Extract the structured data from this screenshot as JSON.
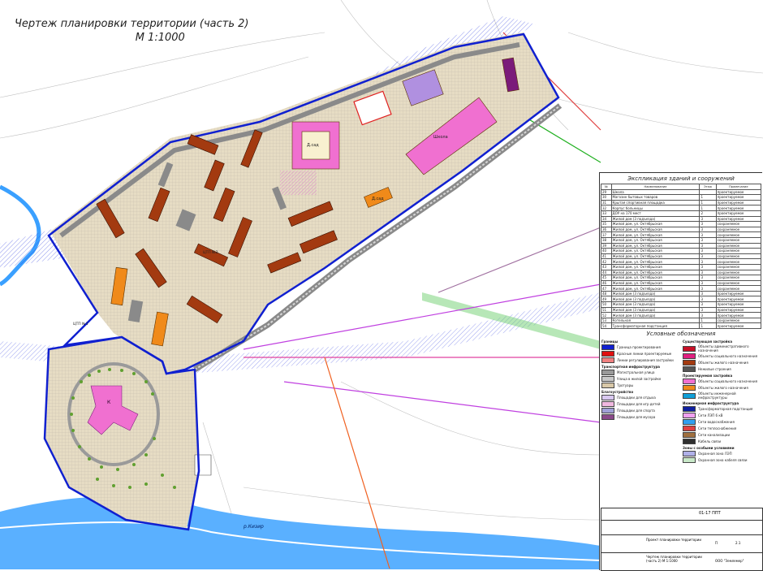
{
  "title": {
    "line1": "Чертеж планировки территории (часть 2)",
    "line2": "М 1:1000"
  },
  "map_labels": {
    "school": "Школа",
    "kindergarten1": "Д.сад",
    "kindergarten2": "Д.сад",
    "hospital": "К",
    "river": "р.Кизир",
    "cp1": "ЦТП №1",
    "cp2": "ЦТП №2"
  },
  "colors": {
    "boundary": "#1020d0",
    "residential": "#a33a10",
    "social": "#f08a1a",
    "social_pink": "#f070d0",
    "infra": "#7a1a7a",
    "river": "#3aa0ff",
    "road": "#8a8a8a",
    "ground": "#e6dcc4"
  },
  "explication": {
    "title": "Экспликация зданий и сооружений",
    "headers": [
      "№",
      "Наименование",
      "Этаж",
      "Примечание"
    ],
    "rows": [
      [
        "29",
        "Школа",
        "",
        "проектируемое"
      ],
      [
        "30",
        "Магазин бытовых товаров",
        "1",
        "проектируемое"
      ],
      [
        "31",
        "Крытая спортивная площадка",
        "1",
        "проектируемое"
      ],
      [
        "32",
        "Корпус больницы",
        "1",
        "проектируемое"
      ],
      [
        "33",
        "ДОУ на 170 мест",
        "2",
        "проектируемое"
      ],
      [
        "34",
        "Жилой дом (3 подъезда)",
        "3",
        "проектируемое"
      ],
      [
        "35",
        "Жилой дом, ул. Октябрьская",
        "3",
        "сохраняемое"
      ],
      [
        "36",
        "Жилой дом, ул. Октябрьская",
        "3",
        "сохраняемое"
      ],
      [
        "37",
        "Жилой дом, ул. Октябрьская",
        "3",
        "сохраняемое"
      ],
      [
        "38",
        "Жилой дом, ул. Октябрьская",
        "3",
        "сохраняемое"
      ],
      [
        "39",
        "Жилой дом, ул. Октябрьская",
        "3",
        "сохраняемое"
      ],
      [
        "40",
        "Жилой дом, ул. Октябрьская",
        "3",
        "сохраняемое"
      ],
      [
        "41",
        "Жилой дом, ул. Октябрьская",
        "3",
        "сохраняемое"
      ],
      [
        "42",
        "Жилой дом, ул. Октябрьская",
        "3",
        "сохраняемое"
      ],
      [
        "43",
        "Жилой дом, ул. Октябрьская",
        "3",
        "сохраняемое"
      ],
      [
        "44",
        "Жилой дом, ул. Октябрьская",
        "3",
        "сохраняемое"
      ],
      [
        "45",
        "Жилой дом, ул. Октябрьская",
        "3",
        "сохраняемое"
      ],
      [
        "46",
        "Жилой дом, ул. Октябрьская",
        "3",
        "сохраняемое"
      ],
      [
        "47",
        "Жилой дом, ул. Октябрьская",
        "3",
        "сохраняемое"
      ],
      [
        "48",
        "Жилой дом (3 подъезда)",
        "3",
        "проектируемое"
      ],
      [
        "49",
        "Жилой дом (3 подъезда)",
        "3",
        "проектируемое"
      ],
      [
        "50",
        "Жилой дом (3 подъезда)",
        "3",
        "проектируемое"
      ],
      [
        "51",
        "Жилой дом (3 подъезда)",
        "3",
        "проектируемое"
      ],
      [
        "52",
        "Жилой дом (3 подъезда)",
        "3",
        "проектируемое"
      ],
      [
        "53",
        "Котельная",
        "1",
        "сохраняемое"
      ],
      [
        "54",
        "Трансформаторная подстанция",
        "1",
        "проектируемое"
      ]
    ]
  },
  "legend": {
    "title": "Условные обозначения",
    "left": [
      {
        "group": "Границы"
      },
      {
        "label": "Граница проектирования",
        "color": "#1020d0"
      },
      {
        "label": "Красные линии проектируемые",
        "color": "#e01010"
      },
      {
        "label": "Линии регулирования застройки",
        "color": "#f08080"
      },
      {
        "group": "Транспортная инфраструктура"
      },
      {
        "label": "Магистральная улица",
        "color": "#9a9a9a"
      },
      {
        "label": "Улица в жилой застройке",
        "color": "#c8c8c8"
      },
      {
        "label": "Тротуары",
        "color": "#d8c8a8"
      },
      {
        "group": "Благоустройство"
      },
      {
        "label": "Площадки для отдыха",
        "color": "#d8c8f0"
      },
      {
        "label": "Площадки для игр детей",
        "color": "#f0b8e0"
      },
      {
        "label": "Площадки для спорта",
        "color": "#a0a0d8"
      },
      {
        "label": "Площадки для мусора",
        "color": "#8a4a8a"
      }
    ],
    "right": [
      {
        "group": "Существующая застройка"
      },
      {
        "label": "Объекты административного назначения",
        "color": "#c81028"
      },
      {
        "label": "Объекты социального назначения",
        "color": "#e02080"
      },
      {
        "label": "Объекты жилого назначения",
        "color": "#a33a10"
      },
      {
        "label": "Нежилые строения",
        "color": "#555555"
      },
      {
        "group": "Проектируемая застройка"
      },
      {
        "label": "Объекты социального назначения",
        "color": "#f070d0"
      },
      {
        "label": "Объекты жилого назначения",
        "color": "#f08a1a"
      },
      {
        "label": "Объекты инженерной инфраструктуры",
        "color": "#10a0d8"
      },
      {
        "group": "Инженерная инфраструктура"
      },
      {
        "label": "Трансформаторная подстанция",
        "color": "#1020a0"
      },
      {
        "label": "Сети ЛЭП 6 кВ",
        "color": "#f0a0f0"
      },
      {
        "label": "Сети водоснабжения",
        "color": "#30a0f0"
      },
      {
        "label": "Сети теплоснабжения",
        "color": "#e04040"
      },
      {
        "label": "Сети канализации",
        "color": "#a07040"
      },
      {
        "label": "Кабель связи",
        "color": "#303030"
      },
      {
        "group": "Зоны с особыми условиями"
      },
      {
        "label": "Охранная зона ЛЭП",
        "color": "#b0b0e8"
      },
      {
        "label": "Охранная зона кабеля связи",
        "color": "#c8e8c8"
      }
    ]
  },
  "stamp": {
    "code": "01-17 ППТ",
    "project": "Проект планировки территории",
    "drawing": "Чертеж планировки территории (часть 2) М 1:1000",
    "stage": "П",
    "sheet": "2.1",
    "org": "ООО \"Землемер\""
  }
}
